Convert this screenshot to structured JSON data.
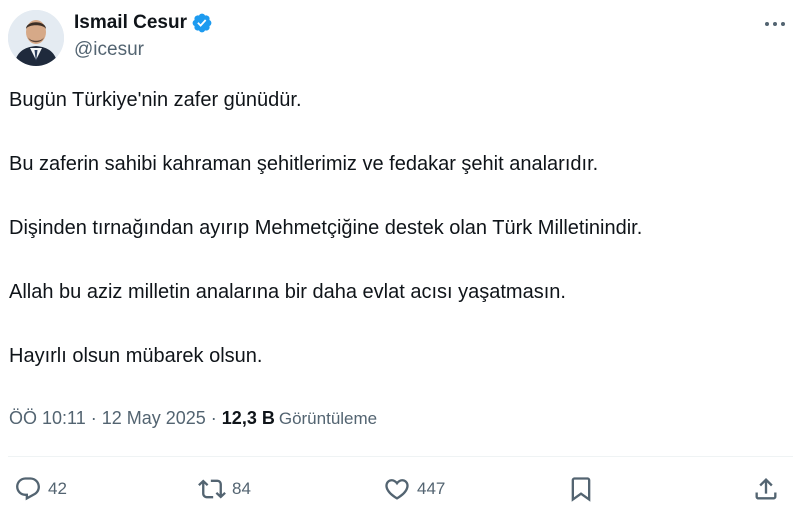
{
  "author": {
    "display_name": "Ismail Cesur",
    "handle": "@icesur",
    "verified": true
  },
  "tweet": {
    "paragraphs": [
      "Bugün Türkiye'nin zafer günüdür.",
      "Bu zaferin sahibi kahraman şehitlerimiz ve fedakar şehit analarıdır.",
      "Dişinden tırnağından ayırıp Mehmetçiğine destek olan Türk Milletinindir.",
      "Allah bu aziz milletin analarına bir daha evlat acısı yaşatmasın.",
      "Hayırlı olsun mübarek olsun."
    ]
  },
  "meta": {
    "time": "ÖÖ 10:11",
    "separator": "·",
    "date": "12 May 2025",
    "views_count": "12,3 B",
    "views_label": "Görüntüleme"
  },
  "actions": {
    "replies": "42",
    "retweets": "84",
    "likes": "447"
  },
  "colors": {
    "accent": "#1d9bf0",
    "text_primary": "#0f1419",
    "text_secondary": "#536471",
    "divider": "#eff3f4"
  },
  "icons": [
    "verified-badge-icon",
    "more-options-icon",
    "reply-icon",
    "retweet-icon",
    "like-icon",
    "bookmark-icon",
    "share-icon"
  ]
}
